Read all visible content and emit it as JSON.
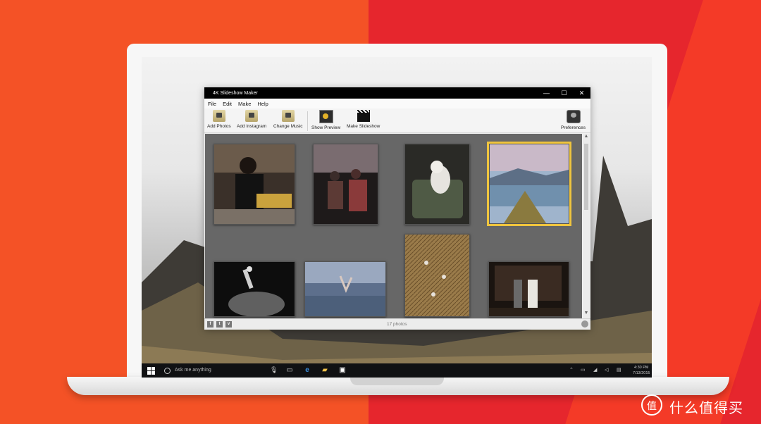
{
  "app": {
    "title": "4K Slideshow Maker",
    "window_controls": {
      "minimize": "—",
      "maximize": "☐",
      "close": "✕"
    },
    "menu": [
      "File",
      "Edit",
      "Make",
      "Help"
    ],
    "toolbar": {
      "add_photos": "Add Photos",
      "add_instagram": "Add Instagram",
      "change_music": "Change Music",
      "show_preview": "Show Preview",
      "make_slideshow": "Make Slideshow",
      "preferences": "Preferences"
    },
    "status": {
      "photo_count": "17 photos",
      "social": [
        "f",
        "t",
        "v"
      ]
    },
    "photos": [
      {
        "name": "boy-with-noodles"
      },
      {
        "name": "people-on-hill"
      },
      {
        "name": "dog-on-chair"
      },
      {
        "name": "lake-mountain-view"
      },
      {
        "name": "skateboard-jump"
      },
      {
        "name": "beach-dancer"
      },
      {
        "name": "grain-field"
      },
      {
        "name": "wedding-stage"
      }
    ],
    "selected_photo": "lake-mountain-view",
    "scroll_arrows": {
      "up": "▲",
      "down": "▼"
    }
  },
  "taskbar": {
    "search_placeholder": "Ask me anything",
    "time": "4:30 PM",
    "date": "7/13/2015"
  },
  "watermark": {
    "text": "什么值得买"
  },
  "colors": {
    "selection": "#f0c53e",
    "gallery_bg": "#676767",
    "accent_red": "#e6262d"
  }
}
